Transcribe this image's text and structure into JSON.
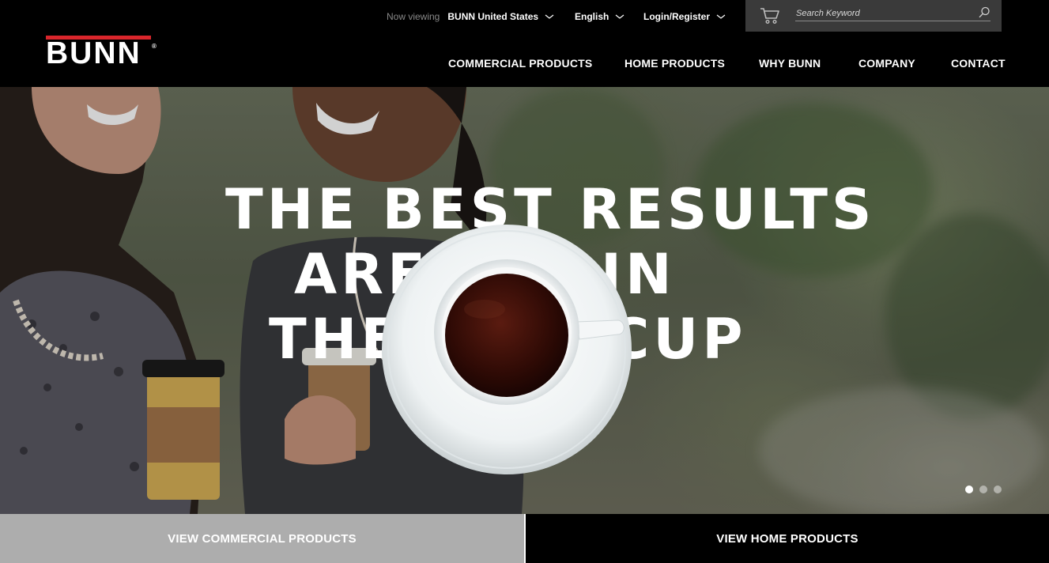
{
  "header": {
    "logo_text": "BUNN",
    "logo_mark": "®",
    "now_viewing_label": "Now viewing",
    "region": "BUNN United States",
    "language": "English",
    "login": "Login/Register",
    "search_placeholder": "Search Keyword",
    "cart_icon": "cart-icon",
    "search_icon": "search-icon"
  },
  "nav": {
    "items": [
      {
        "label": "COMMERCIAL PRODUCTS"
      },
      {
        "label": "HOME PRODUCTS"
      },
      {
        "label": "WHY BUNN"
      },
      {
        "label": "COMPANY"
      },
      {
        "label": "CONTACT"
      }
    ]
  },
  "hero": {
    "headline": {
      "line1": "THE BEST RESULTS",
      "line2_left": "ARE",
      "line2_right": "IN",
      "line3_left": "THE",
      "line3_right": "CUP"
    },
    "slides_total": 3,
    "active_slide": 1
  },
  "cta": {
    "commercial": "VIEW COMMERCIAL PRODUCTS",
    "home": "VIEW HOME PRODUCTS"
  },
  "colors": {
    "brand_red": "#d9262c",
    "header_bg": "#000000",
    "search_bg": "#3a3a3a",
    "cta_gray": "#adadad"
  }
}
